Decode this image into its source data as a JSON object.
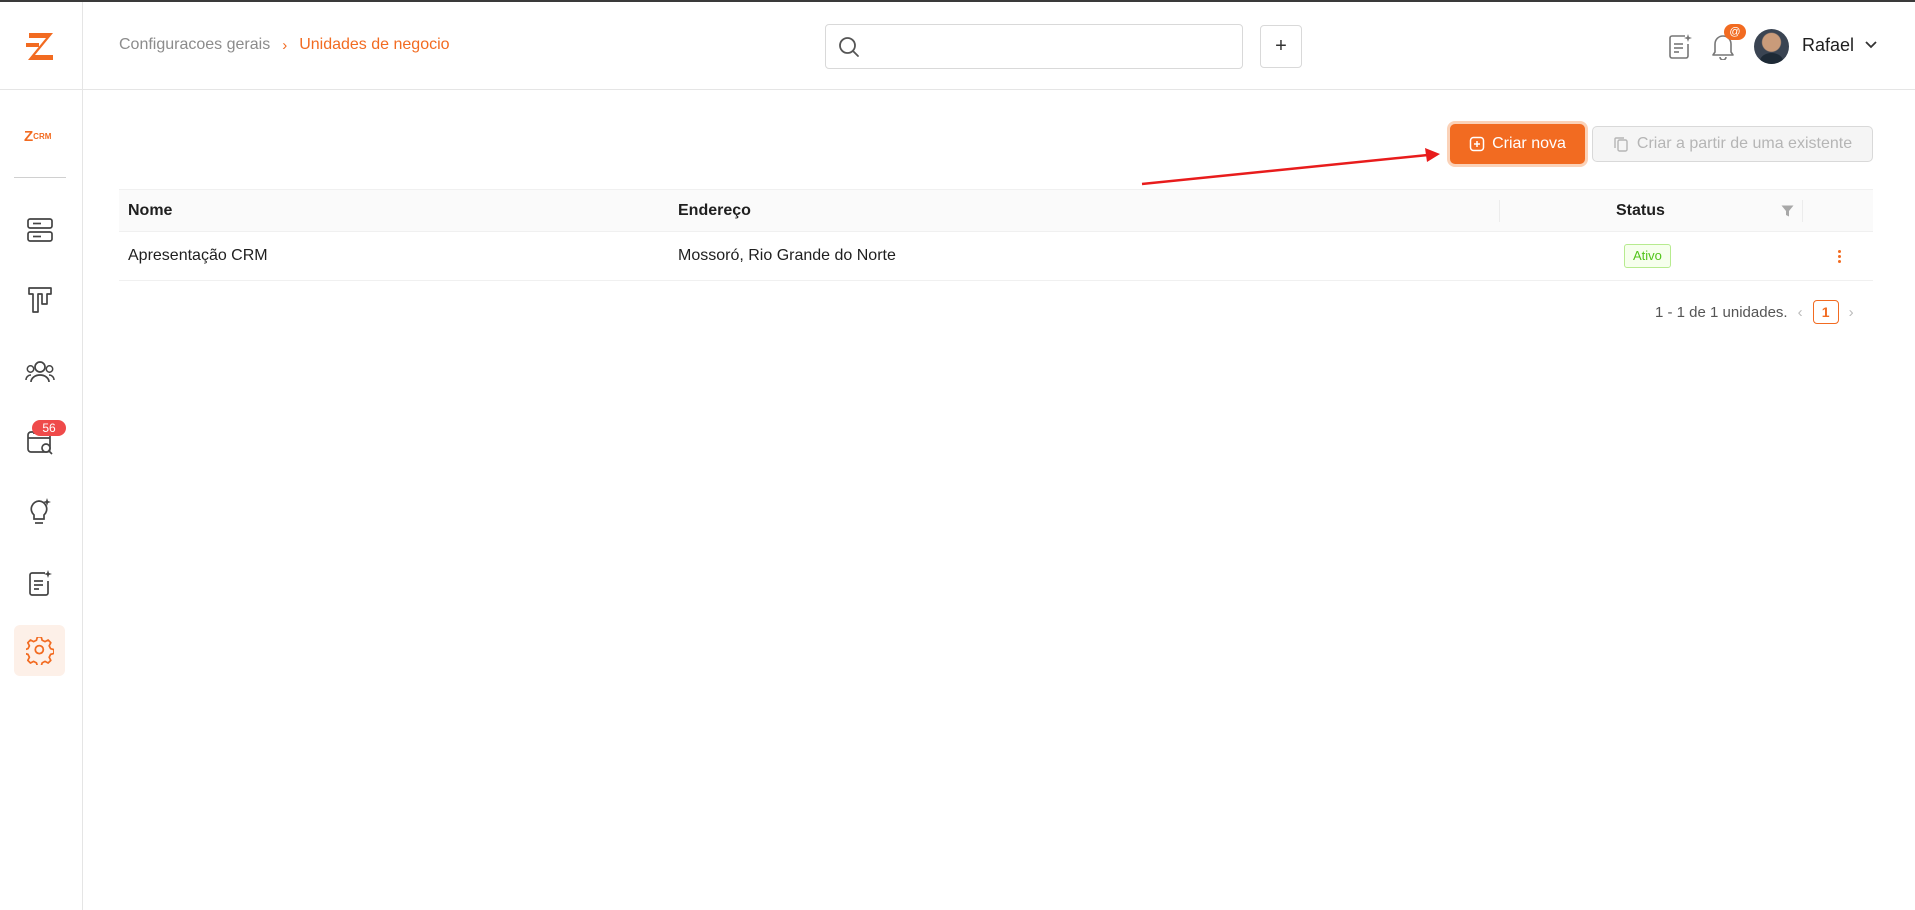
{
  "header": {
    "breadcrumb": {
      "root": "Configuracoes gerais",
      "separator": "›",
      "current": "Unidades de negocio"
    },
    "search": {
      "value": "",
      "placeholder": ""
    },
    "add_label": "+",
    "notification_badge": "@",
    "user": {
      "name": "Rafael"
    }
  },
  "sidebar": {
    "brand": {
      "letter": "Z",
      "suffix": "CRM"
    },
    "items": [
      {
        "icon": "server-icon"
      },
      {
        "icon": "kanban-icon"
      },
      {
        "icon": "users-icon"
      },
      {
        "icon": "calendar-search-icon",
        "badge": "56"
      },
      {
        "icon": "lightbulb-icon"
      },
      {
        "icon": "note-icon"
      },
      {
        "icon": "gear-icon",
        "active": true
      }
    ]
  },
  "actions": {
    "create_new": "Criar nova",
    "create_from_existing": "Criar a partir de uma existente"
  },
  "table": {
    "columns": [
      "Nome",
      "Endereço",
      "Status"
    ],
    "rows": [
      {
        "nome": "Apresentação CRM",
        "endereco": "Mossoró, Rio Grande do Norte",
        "status": "Ativo"
      }
    ]
  },
  "pagination": {
    "summary": "1 - 1 de 1 unidades.",
    "current_page": "1",
    "prev": "‹",
    "next": "›"
  },
  "colors": {
    "accent": "#f26b21",
    "status_active": "#52c41a",
    "badge_red": "#ef4a4a",
    "annotation_arrow": "#e81c1c"
  }
}
